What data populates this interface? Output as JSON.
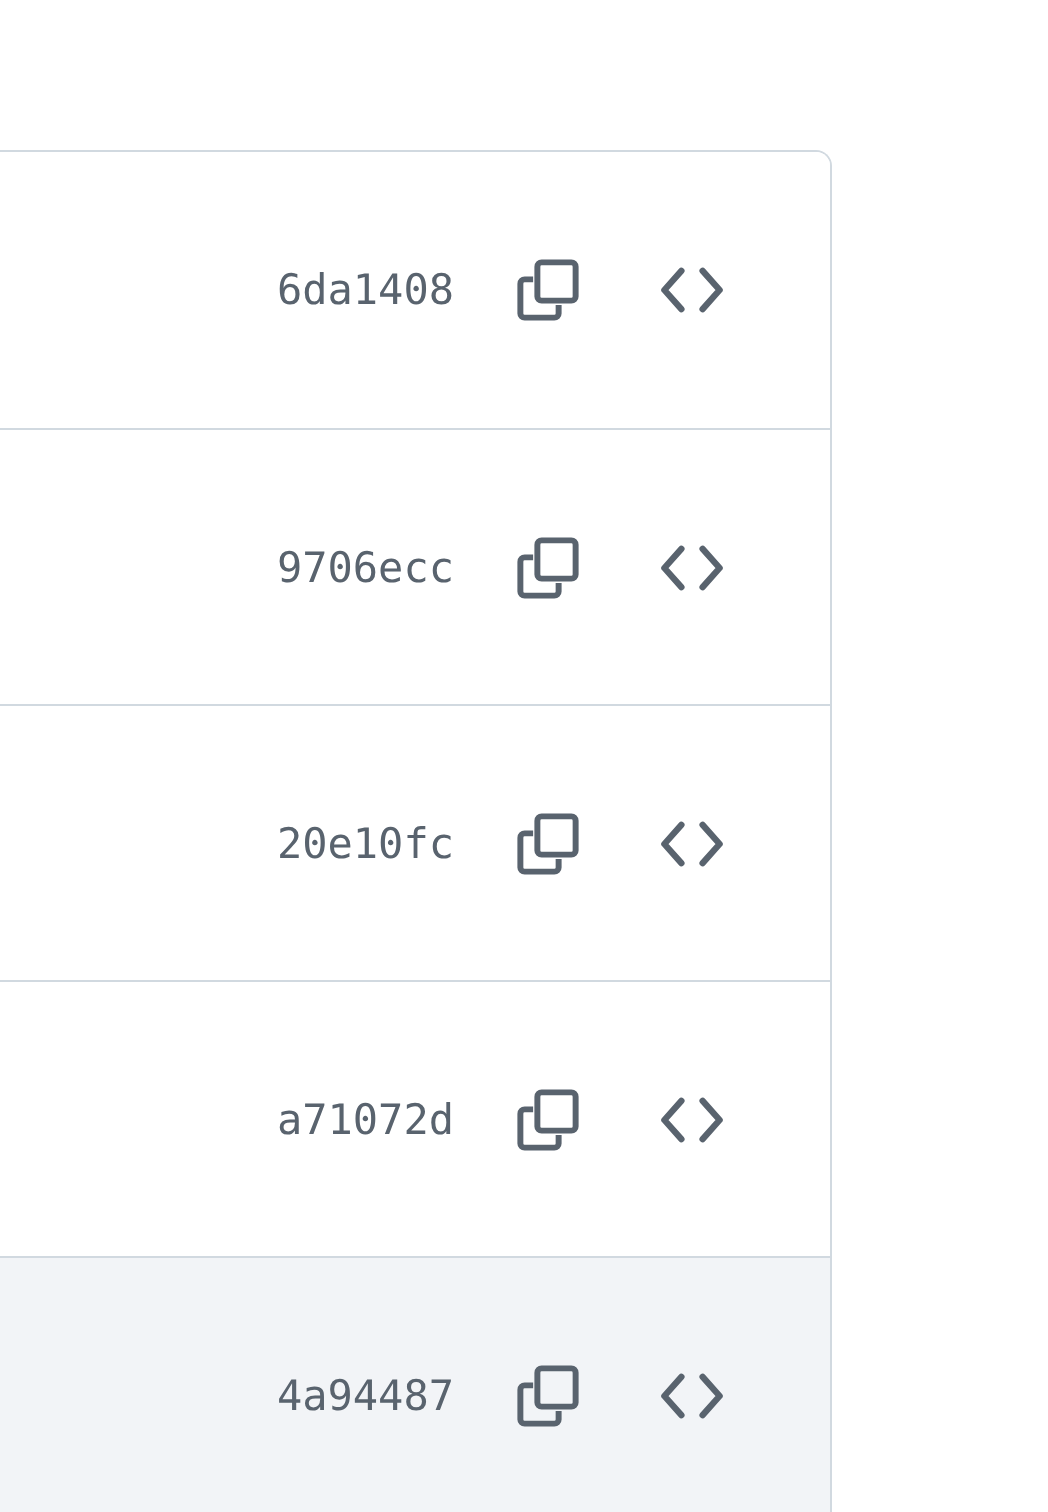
{
  "commits": [
    {
      "hash": "6da1408",
      "highlighted": false
    },
    {
      "hash": "9706ecc",
      "highlighted": false
    },
    {
      "hash": "20e10fc",
      "highlighted": false
    },
    {
      "hash": "a71072d",
      "highlighted": false
    },
    {
      "hash": "4a94487",
      "highlighted": true
    }
  ]
}
